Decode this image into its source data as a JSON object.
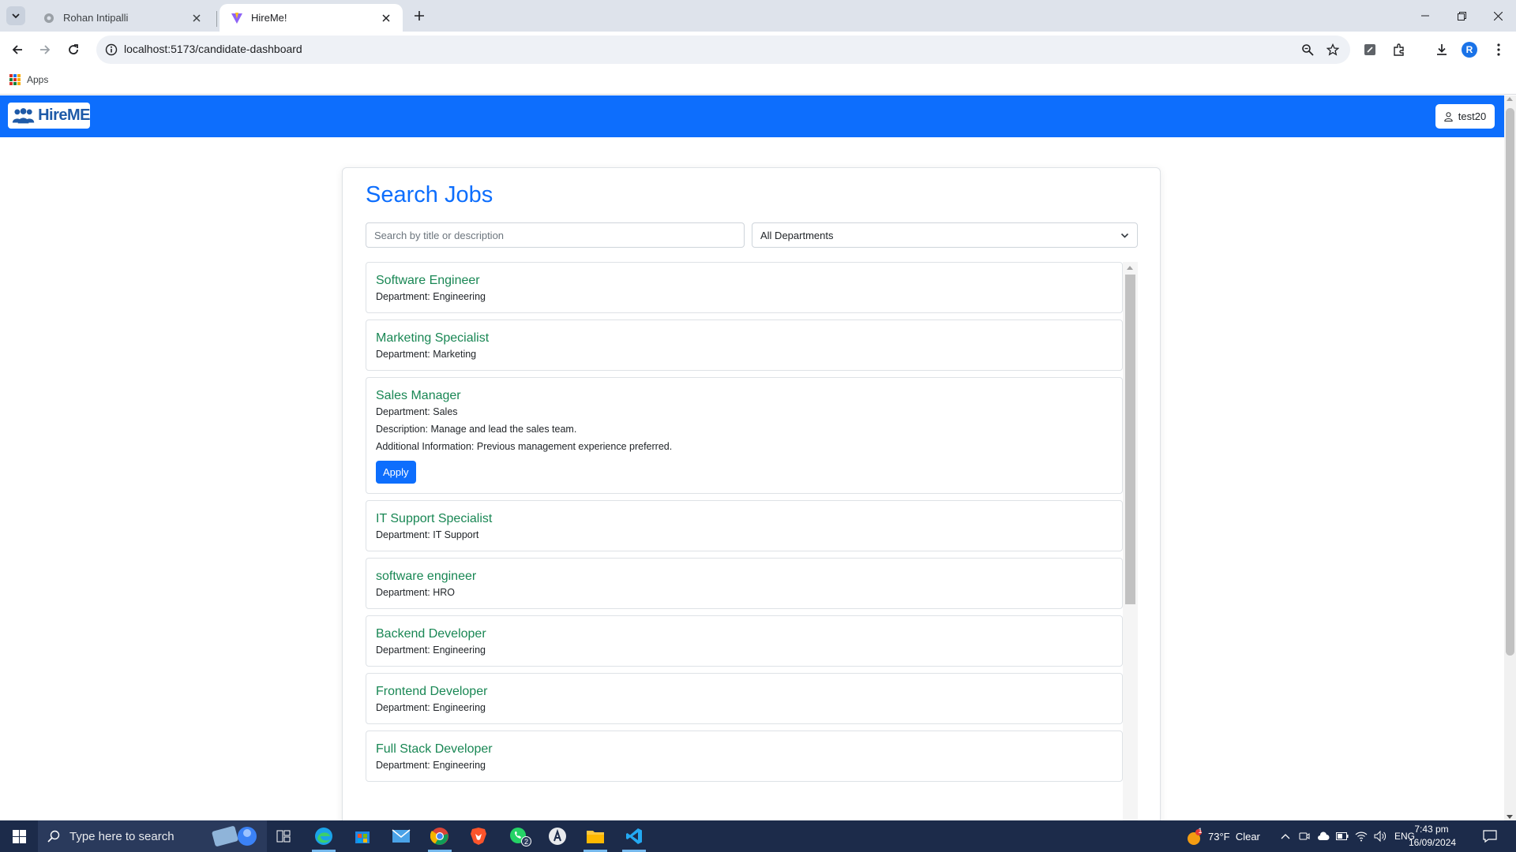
{
  "browser": {
    "tabs": [
      {
        "label": "Rohan Intipalli"
      },
      {
        "label": "HireMe!"
      }
    ],
    "url": "localhost:5173/candidate-dashboard",
    "profile_initial": "R",
    "bookmarks": {
      "apps_label": "Apps"
    }
  },
  "navbar": {
    "brand": "HireME",
    "user_label": "test20"
  },
  "main": {
    "heading": "Search Jobs",
    "search_placeholder": "Search by title or description",
    "department_selected": "All Departments"
  },
  "jobs": [
    {
      "title": "Software Engineer",
      "department": "Department: Engineering"
    },
    {
      "title": "Marketing Specialist",
      "department": "Department: Marketing"
    },
    {
      "title": "Sales Manager",
      "department": "Department: Sales",
      "description": "Description: Manage and lead the sales team.",
      "additional_info": "Additional Information: Previous management experience preferred.",
      "apply_label": "Apply"
    },
    {
      "title": "IT Support Specialist",
      "department": "Department: IT Support"
    },
    {
      "title": "software engineer",
      "department": "Department: HRO"
    },
    {
      "title": "Backend Developer",
      "department": "Department: Engineering"
    },
    {
      "title": "Frontend Developer",
      "department": "Department: Engineering"
    },
    {
      "title": "Full Stack Developer",
      "department": "Department: Engineering"
    }
  ],
  "taskbar": {
    "search_placeholder": "Type here to search",
    "whatsapp_badge": "2",
    "weather_badge": "1",
    "weather": "73°F  Clear",
    "language": "ENG",
    "time": "7:43 pm",
    "date": "16/09/2024"
  },
  "colors": {
    "navbar": "#0d6efd",
    "heading": "#0d6efd",
    "job_title": "#198754",
    "apply_button": "#0d6efd",
    "taskbar": "#1c2b4a"
  }
}
